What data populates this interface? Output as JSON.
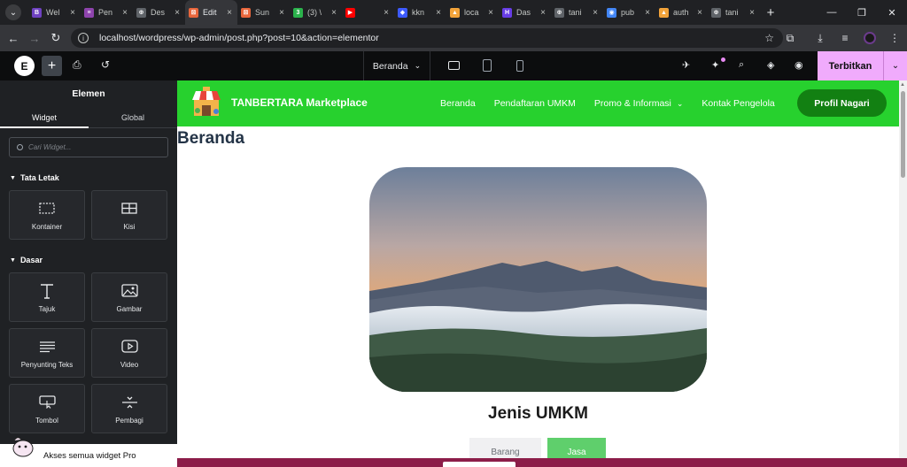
{
  "browser": {
    "tabs": [
      {
        "title": "Wel",
        "icon": "bootstrap-icon",
        "color": "#6f42c1",
        "glyph": "B"
      },
      {
        "title": "Pen",
        "icon": "elementor-form-icon",
        "color": "#8e44ad",
        "glyph": "≡"
      },
      {
        "title": "Des",
        "icon": "wordpress-icon",
        "color": "#5f6368",
        "glyph": "⊕"
      },
      {
        "title": "Edit",
        "icon": "elementor-edit-icon",
        "color": "#e8663c",
        "glyph": "⊠"
      },
      {
        "title": "Sun",
        "icon": "elementor-edit-icon",
        "color": "#e8663c",
        "glyph": "⊠"
      },
      {
        "title": "(3) \\",
        "icon": "whatsapp-icon",
        "color": "#2bb24c",
        "glyph": "3"
      },
      {
        "title": "",
        "icon": "youtube-icon",
        "color": "#ff0000",
        "glyph": "▶"
      },
      {
        "title": "kkn",
        "icon": "shield-icon",
        "color": "#3d5afe",
        "glyph": "◆"
      },
      {
        "title": "loca",
        "icon": "xampp-icon",
        "color": "#f2a33a",
        "glyph": "▲"
      },
      {
        "title": "Das",
        "icon": "hostinger-icon",
        "color": "#673de6",
        "glyph": "H"
      },
      {
        "title": "tani",
        "icon": "globe-icon",
        "color": "#5f6368",
        "glyph": "⊕"
      },
      {
        "title": "pub",
        "icon": "public-icon",
        "color": "#4285f4",
        "glyph": "◉"
      },
      {
        "title": "auth",
        "icon": "xampp-icon",
        "color": "#f2a33a",
        "glyph": "▲"
      },
      {
        "title": "tani",
        "icon": "globe-icon",
        "color": "#5f6368",
        "glyph": "⊕"
      }
    ],
    "active_tab_index": 3,
    "url": "localhost/wordpress/wp-admin/post.php?post=10&action=elementor"
  },
  "editor": {
    "page_selector": "Beranda",
    "publish_label": "Terbitkan",
    "colors": {
      "publish": "#f0abfc",
      "topbar": "#0c0d0e",
      "panel": "#1f2124"
    }
  },
  "panel": {
    "title": "Elemen",
    "tabs": [
      "Widget",
      "Global"
    ],
    "search_placeholder": "Cari Widget...",
    "sections": [
      {
        "title": "Tata Letak",
        "widgets": [
          {
            "label": "Kontainer",
            "icon": "container-icon"
          },
          {
            "label": "Kisi",
            "icon": "grid-icon"
          }
        ]
      },
      {
        "title": "Dasar",
        "widgets": [
          {
            "label": "Tajuk",
            "icon": "heading-icon"
          },
          {
            "label": "Gambar",
            "icon": "image-icon"
          },
          {
            "label": "Penyunting Teks",
            "icon": "text-editor-icon"
          },
          {
            "label": "Video",
            "icon": "video-icon"
          },
          {
            "label": "Tombol",
            "icon": "button-icon"
          },
          {
            "label": "Pembagi",
            "icon": "divider-icon"
          }
        ]
      }
    ],
    "pro_banner": "Akses semua widget Pro"
  },
  "site": {
    "name": "TANBERTARA Marketplace",
    "nav": [
      "Beranda",
      "Pendaftaran UMKM",
      "Promo & Informasi",
      "Kontak Pengelola"
    ],
    "cta": "Profil Nagari",
    "page_title": "Beranda",
    "section_title": "Jenis UMKM",
    "buttons": [
      "Barang",
      "Jasa"
    ],
    "colors": {
      "header": "#27d12e",
      "cta": "#128012",
      "active_button": "#5fcf6c"
    }
  }
}
